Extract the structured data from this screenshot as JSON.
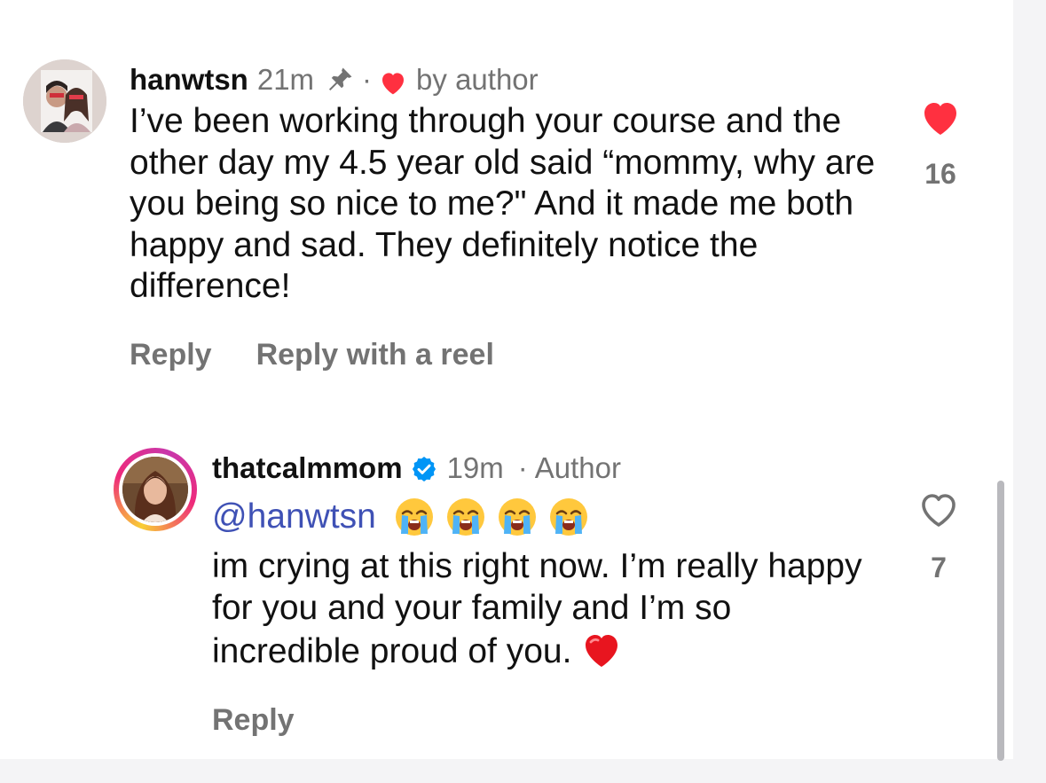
{
  "comments": [
    {
      "username": "hanwtsn",
      "time": "21m",
      "separator": "·",
      "liked_label": "by author",
      "text": "I’ve been working through your course and the other day my 4.5 year old said “mommy, why are you being so nice to me?\" And it made me both happy and sad. They definitely notice the difference!",
      "like_count": "16",
      "liked": true,
      "actions": {
        "reply": "Reply",
        "reply_reel": "Reply with a reel"
      }
    },
    {
      "username": "thatcalmmom",
      "verified": true,
      "time": "19m",
      "separator": "·",
      "role": "Author",
      "mention": "@hanwtsn",
      "emojis": [
        "loudly-crying-face",
        "loudly-crying-face",
        "loudly-crying-face",
        "loudly-crying-face"
      ],
      "text": "im crying at this right now. I’m really happy for you and your family and I’m so incredible proud of you.",
      "trailing_emoji": "red-heart",
      "like_count": "7",
      "liked": false,
      "actions": {
        "reply": "Reply"
      }
    }
  ],
  "colors": {
    "like_red": "#ff3040",
    "mention_blue": "#3f51b5",
    "verified_blue": "#0095f6",
    "muted_text": "#737373"
  }
}
